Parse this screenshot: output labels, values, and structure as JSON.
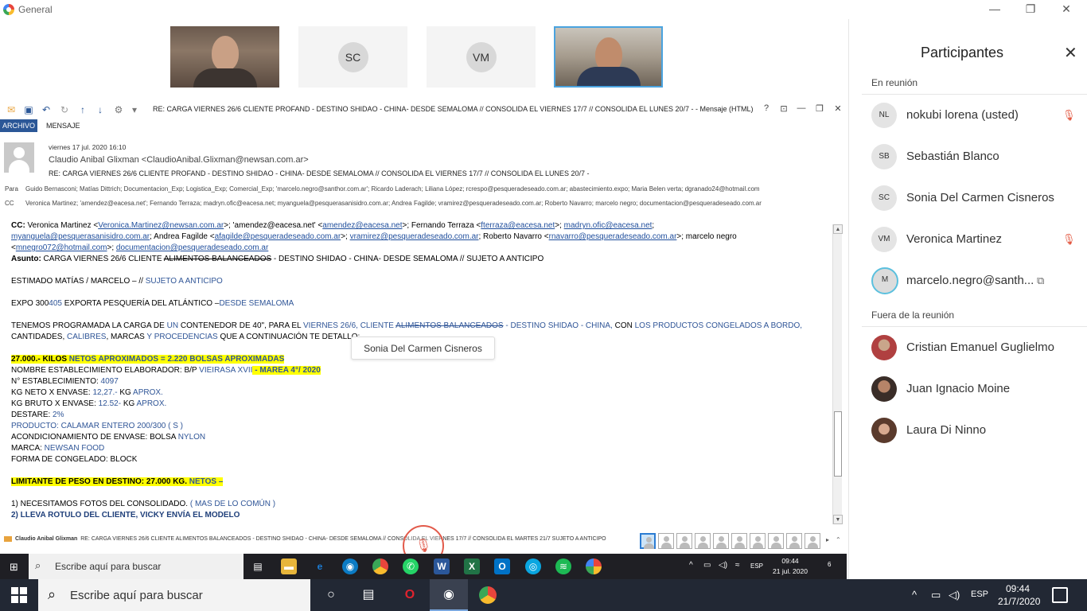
{
  "app": {
    "title": "General"
  },
  "window_controls": {
    "minimize": "—",
    "restore": "❐",
    "close": "✕"
  },
  "tiles": [
    {
      "kind": "video",
      "name": ""
    },
    {
      "kind": "initials",
      "initials": "SC"
    },
    {
      "kind": "initials",
      "initials": "VM"
    },
    {
      "kind": "video",
      "name": ""
    }
  ],
  "outlook": {
    "window_title": "RE: CARGA VIERNES 26/6 CLIENTE PROFAND - DESTINO SHIDAO - CHINA- DESDE SEMALOMA  //  CONSOLIDA EL VIERNES 17/7 //  CONSOLIDA EL LUNES 20/7 -  - Mensaje (HTML)",
    "controls": {
      "help": "?",
      "ribbon": "⊡",
      "minimize": "—",
      "restore": "❐",
      "close": "✕"
    },
    "tabs": {
      "file": "ARCHIVO",
      "message": "MENSAJE"
    },
    "header": {
      "date": "viernes 17 jul. 2020 16:10",
      "from": "Claudio Anibal Glixman <ClaudioAnibal.Glixman@newsan.com.ar>",
      "subject": "RE: CARGA VIERNES 26/6 CLIENTE PROFAND - DESTINO SHIDAO - CHINA- DESDE SEMALOMA  //  CONSOLIDA EL VIERNES 17/7 //  CONSOLIDA EL LUNES 20/7 -",
      "to_label": "Para",
      "to": "Guido Bernasconi; Matías Dittrich; Documentacion_Exp; Logistica_Exp; Comercial_Exp; 'marcelo.negro@santhor.com.ar'; Ricardo Laderach; Liliana López; rcrespo@pesqueradeseado.com.ar; abastecimiento.expo; Maria Belen verta; dgranado24@hotmail.com",
      "cc_label": "CC",
      "cc": "Veronica Martinez; 'amendez@eacesa.net'; Fernando Terraza; madryn.ofic@eacesa.net; myanguela@pesquerasanisidro.com.ar; Andrea Fagilde; vramirez@pesqueradeseado.com.ar; Roberto Navarro; marcelo negro; documentacion@pesqueradeseado.com.ar"
    },
    "body": {
      "cc_line_label": "CC:",
      "cc_line1_a": " Veronica Martinez <",
      "cc_line1_link1": "Veronica.Martinez@newsan.com.ar",
      "cc_line1_b": ">; 'amendez@eacesa.net' <",
      "cc_line1_link2": "amendez@eacesa.net",
      "cc_line1_c": ">; Fernando Terraza <",
      "cc_line1_link3": "fterraza@eacesa.net",
      "cc_line1_d": ">; ",
      "cc_line1_link4": "madryn.ofic@eacesa.net",
      "cc_line1_e": ";",
      "cc_line2_link1": "myanguela@pesquerasanisidro.com.ar",
      "cc_line2_a": "; Andrea Fagilde <",
      "cc_line2_link2": "afagilde@pesqueradeseado.com.ar",
      "cc_line2_b": ">; ",
      "cc_line2_link3": "vramirez@pesqueradeseado.com.ar",
      "cc_line2_c": "; Roberto Navarro <",
      "cc_line2_link4": "rnavarro@pesqueradeseado.com.ar",
      "cc_line2_d": ">; marcelo negro",
      "cc_line3_a": "<",
      "cc_line3_link1": "mnegro072@hotmail.com",
      "cc_line3_b": ">; ",
      "cc_line3_link2": "documentacion@pesqueradeseado.com.ar",
      "subject_label": "Asunto:",
      "subject_a": " CARGA VIERNES 26/6 CLIENTE ",
      "subject_strike": "ALIMENTOS BALANCEADOS",
      "subject_b": " - DESTINO SHIDAO - CHINA- DESDE SEMALOMA // SUJETO A ANTICIPO",
      "greeting_a": "ESTIMADO MATÍAS / MARCELO – // ",
      "greeting_b": "SUJETO A ANTICIPO",
      "expo_a": "EXPO 300",
      "expo_b": "405",
      "expo_c": " EXPORTA PESQUERÍA DEL ATLÁNTICO –",
      "expo_d": "DESDE SEMALOMA",
      "p1_a": "TENEMOS PROGRAMADA LA CARGA DE ",
      "p1_b": "UN",
      "p1_c": " CONTENEDOR DE 40\", PARA EL ",
      "p1_d": "VIERNES 26/6,  CLIENTE ",
      "p1_strike": "ALIMENTOS BALANCEADOS",
      "p1_e": " - DESTINO SHIDAO - CHINA,",
      "p1_f": " CON ",
      "p1_g": "LOS PRODUCTOS CONGELADOS A BORDO,",
      "p2_a": "CANTIDADES, ",
      "p2_b": "CALIBRES",
      "p2_c": ", MARCAS ",
      "p2_d": "Y PROCEDENCIAS",
      "p2_e": " QUE A CONTINUACIÓN TE DETALLO:",
      "kilos_a": "27.000.- KILOS",
      "kilos_b": " NETOS APROXIMADOS = 2.220 BOLSAS APROXIMADAS",
      "est_a": "NOMBRE ESTABLECIMIENTO ELABORADOR:  B/P ",
      "est_b": "VIEIRASA XVII",
      "est_c": "  -  MAREA 4°/ 2020",
      "num_a": "N° ESTABLECIMIENTO: ",
      "num_b": "4097",
      "neto_a": "KG NETO X ENVASE: ",
      "neto_b": "12,27.- ",
      "neto_c": "KG ",
      "neto_d": "APROX.",
      "bruto_a": "KG BRUTO X ENVASE: ",
      "bruto_b": "12.52- ",
      "bruto_c": "KG ",
      "bruto_d": "APROX.",
      "destare_a": "DESTARE: ",
      "destare_b": "2%",
      "producto": "PRODUCTO: CALAMAR ENTERO 200/300 ( S )",
      "acond_a": "ACONDICIONAMIENTO DE ENVASE: BOLSA ",
      "acond_b": "NYLON",
      "marca_a": "MARCA: ",
      "marca_b": "NEWSAN FOOD",
      "forma": "FORMA DE CONGELADO: BLOCK",
      "limit_a": "LIMITANTE DE PESO EN DESTINO: 27.000 KG.",
      "limit_b": " NETOS –",
      "item1_a": "1) NECESITAMOS FOTOS DEL CONSOLIDADO. ",
      "item1_b": "( MAS DE LO COMÚN )",
      "item2": "2) LLEVA ROTULO DEL CLIENTE, VICKY ENVÍA EL MODELO"
    },
    "scroll": {
      "up": "▲",
      "down": "▼"
    },
    "status": {
      "sender": "Claudio Anibal Glixman",
      "text": "RE: CARGA VIERNES 26/6 CLIENTE ALIMENTOS BALANCEADOS - DESTINO SHIDAO - CHINA- DESDE SEMALOMA  //  CONSOLIDA EL VIERNES 17/7 //  CONSOLIDA EL MARTES 21/7 SUJETO A ANTICIPO"
    },
    "thumb_count": 10
  },
  "hover_tooltip": "Sonia Del Carmen Cisneros",
  "inner_taskbar": {
    "search_placeholder": "Escribe aquí para buscar",
    "lang": "ESP",
    "time": "09:44",
    "date": "21 jul. 2020",
    "notif_count": "6"
  },
  "participants": {
    "title": "Participantes",
    "close": "✕",
    "in_meeting_label": "En reunión",
    "out_meeting_label": "Fuera de la reunión",
    "in_meeting": [
      {
        "initials": "NL",
        "name": "nokubi lorena (usted)",
        "muted": true
      },
      {
        "initials": "SB",
        "name": "Sebastián Blanco",
        "muted": false
      },
      {
        "initials": "SC",
        "name": "Sonia Del Carmen Cisneros",
        "muted": false
      },
      {
        "initials": "VM",
        "name": "Veronica Martinez",
        "muted": true
      },
      {
        "initials": "M",
        "name": "marcelo.negro@santh...",
        "muted": false
      }
    ],
    "out_meeting": [
      {
        "name": "Cristian Emanuel Guglielmo"
      },
      {
        "name": "Juan Ignacio Moine"
      },
      {
        "name": "Laura Di Ninno"
      }
    ]
  },
  "taskbar": {
    "search_placeholder": "Escribe aquí para buscar",
    "lang": "ESP",
    "time": "09:44",
    "date": "21/7/2020"
  }
}
